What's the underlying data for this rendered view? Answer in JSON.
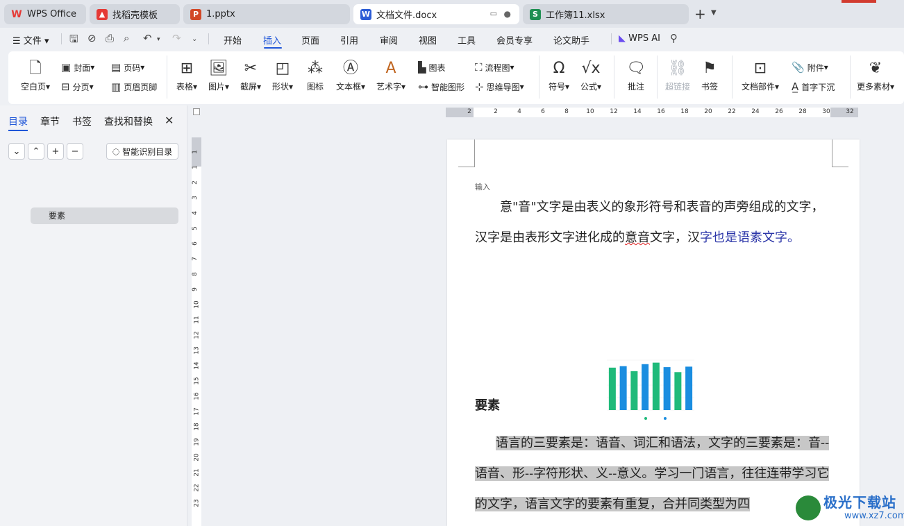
{
  "tabs": [
    {
      "label": "WPS Office",
      "icon": "wps-logo-icon",
      "color": "#e53935"
    },
    {
      "label": "找稻壳模板",
      "icon": "docer-icon",
      "color": "#e53935"
    },
    {
      "label": "1.pptx",
      "icon": "ppt-icon",
      "color": "#d24726",
      "glyph": "P"
    },
    {
      "label": "文档文件.docx",
      "icon": "word-icon",
      "color": "#2b5cd6",
      "glyph": "W"
    },
    {
      "label": "工作簿11.xlsx",
      "icon": "excel-icon",
      "color": "#1f8f52",
      "glyph": "S"
    }
  ],
  "menu": {
    "file": "文件",
    "items": [
      "开始",
      "插入",
      "页面",
      "引用",
      "审阅",
      "视图",
      "工具",
      "会员专享",
      "论文助手"
    ],
    "active": "插入",
    "ai": "WPS AI"
  },
  "ribbon": {
    "blank_page": "空白页",
    "cover": "封面",
    "page_break": "分页",
    "page_number": "页码",
    "header_footer": "页眉页脚",
    "table": "表格",
    "picture": "图片",
    "screenshot": "截屏",
    "shape": "形状",
    "icon": "图标",
    "textbox": "文本框",
    "wordart": "艺术字",
    "chart": "图表",
    "smartart": "智能图形",
    "flowchart": "流程图",
    "mindmap": "思维导图",
    "symbol": "符号",
    "formula": "公式",
    "comment": "批注",
    "hyperlink": "超链接",
    "bookmark": "书签",
    "doc_parts": "文档部件",
    "attachment": "附件",
    "drop_cap": "首字下沉",
    "more": "更多素材"
  },
  "nav": {
    "tabs": [
      "目录",
      "章节",
      "书签",
      "查找和替换"
    ],
    "smart_toc": "智能识别目录",
    "outline_item": "要素"
  },
  "ruler": {
    "h": [
      "2",
      "2",
      "4",
      "6",
      "8",
      "10",
      "12",
      "14",
      "16",
      "18",
      "20",
      "22",
      "24",
      "26",
      "28",
      "30",
      "32"
    ],
    "v": [
      "1",
      "1",
      "2",
      "3",
      "4",
      "5",
      "6",
      "7",
      "8",
      "9",
      "10",
      "11",
      "12",
      "13",
      "14",
      "15",
      "16",
      "17",
      "18",
      "19",
      "20",
      "21",
      "22",
      "23"
    ]
  },
  "document": {
    "input_hint": "输入",
    "para1_a": "意\"音\"文字是由表义的象形符号和表音的声旁组成的文字，汉字是由表形文字进化成的",
    "para1_err": "意音",
    "para1_b": "文字，汉",
    "para1_blue": "字也是语素文字。",
    "heading": "要素",
    "para2": "语言的三要素是：语音、词汇和语法，文字的三要素是：音--语音、形--字符形状、义--意义。学习一门语言，往往连带学习它的文字，语言文字的要素有重复，合并同类型为四"
  },
  "chart_data": {
    "type": "bar",
    "categories": [
      "",
      "",
      "",
      "",
      "",
      "",
      "",
      "",
      ""
    ],
    "series": [
      {
        "values": [
          85,
          88,
          78,
          92,
          95,
          86,
          76,
          87,
          0
        ],
        "color": "#1fba7a"
      },
      {
        "values": [
          0,
          0,
          0,
          0,
          0,
          0,
          0,
          0,
          0
        ],
        "color": "#1a8de0"
      }
    ],
    "bars": [
      {
        "value": 85,
        "color": "#1fba7a"
      },
      {
        "value": 88,
        "color": "#1a8de0"
      },
      {
        "value": 78,
        "color": "#1fba7a"
      },
      {
        "value": 92,
        "color": "#1a8de0"
      },
      {
        "value": 95,
        "color": "#1fba7a"
      },
      {
        "value": 86,
        "color": "#1a8de0"
      },
      {
        "value": 76,
        "color": "#1fba7a"
      },
      {
        "value": 87,
        "color": "#1a8de0"
      }
    ],
    "ylim": [
      0,
      100
    ]
  },
  "watermark": {
    "text": "极光下载站",
    "url": "www.xz7.com"
  }
}
